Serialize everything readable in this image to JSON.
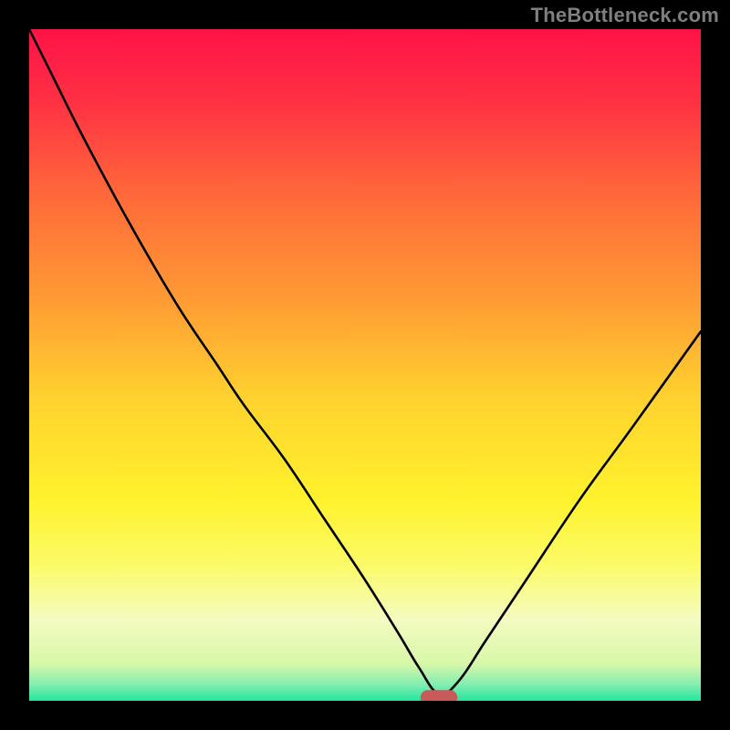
{
  "watermark": "TheBottleneck.com",
  "chart_data": {
    "type": "line",
    "title": "",
    "xlabel": "",
    "ylabel": "",
    "xlim": [
      0,
      100
    ],
    "ylim": [
      0,
      100
    ],
    "background_gradient": {
      "stops": [
        {
          "offset": 0.0,
          "color": "#ff1347"
        },
        {
          "offset": 0.1,
          "color": "#ff2e44"
        },
        {
          "offset": 0.25,
          "color": "#ff6a3a"
        },
        {
          "offset": 0.4,
          "color": "#ff9a34"
        },
        {
          "offset": 0.55,
          "color": "#ffd22f"
        },
        {
          "offset": 0.7,
          "color": "#fff22d"
        },
        {
          "offset": 0.8,
          "color": "#fbfb6a"
        },
        {
          "offset": 0.88,
          "color": "#f4fbc1"
        },
        {
          "offset": 0.945,
          "color": "#d7f7a8"
        },
        {
          "offset": 0.975,
          "color": "#85eeb1"
        },
        {
          "offset": 1.0,
          "color": "#24e59e"
        }
      ]
    },
    "curve": {
      "description": "Bottleneck percentage curve — steep fall from top-left, rounded bend near x≈30, near-linear dive to valley at x≈61, then rise toward x=100.",
      "x": [
        0,
        3,
        8,
        15,
        22,
        28,
        32,
        38,
        44,
        50,
        55,
        58,
        61,
        64,
        68,
        74,
        82,
        90,
        100
      ],
      "y": [
        100,
        94,
        84,
        71,
        59,
        50,
        44,
        36,
        27,
        18,
        10,
        5,
        1,
        3,
        9,
        18,
        30,
        41,
        55
      ]
    },
    "marker": {
      "description": "Rounded red pill marking the optimal / valley point on the x-axis.",
      "x": 61,
      "y": 0.5,
      "width_pct": 5.5,
      "height_pct": 2.2,
      "color": "#c85a5a"
    }
  }
}
